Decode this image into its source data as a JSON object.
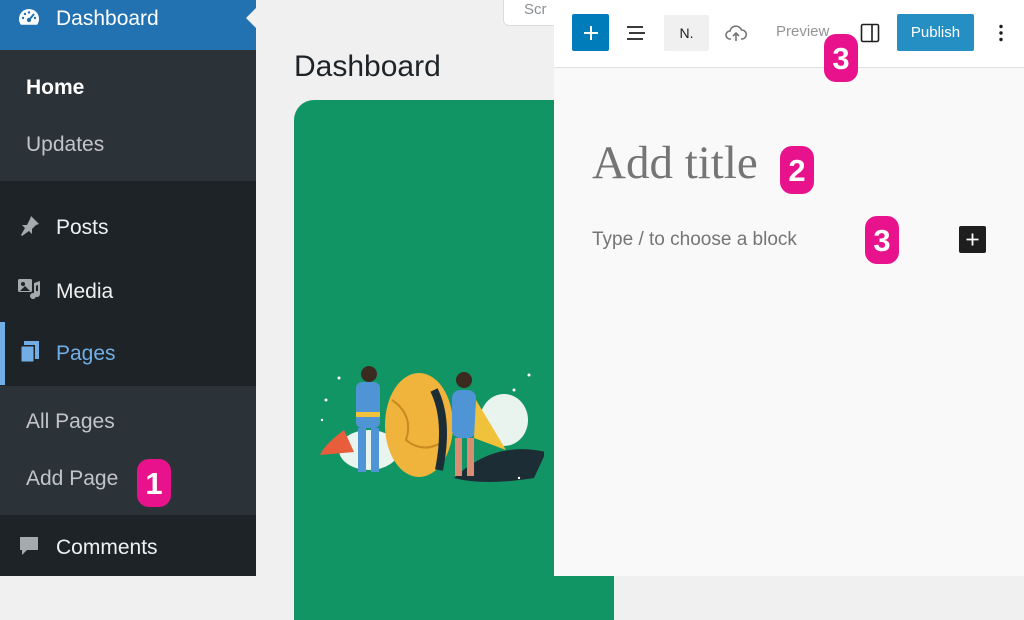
{
  "sidebar": {
    "dashboard_label": "Dashboard",
    "home_label": "Home",
    "updates_label": "Updates",
    "posts_label": "Posts",
    "media_label": "Media",
    "pages_label": "Pages",
    "all_pages_label": "All Pages",
    "add_page_label": "Add Page",
    "comments_label": "Comments"
  },
  "dashboard": {
    "title": "Dashboard",
    "search_placeholder": "Scr"
  },
  "editor": {
    "toolbar": {
      "n_label": "N.",
      "preview_label": "Preview",
      "publish_label": "Publish"
    },
    "title_placeholder": "Add title",
    "block_placeholder": "Type / to choose a block"
  },
  "badges": {
    "add_page": "1",
    "title": "2",
    "toolbar": "3",
    "block": "3"
  },
  "colors": {
    "sidebar_bg": "#1d2327",
    "sidebar_active": "#2271b1",
    "wp_blue": "#007cba",
    "welcome_green": "#119565",
    "badge_pink": "#e8128c"
  },
  "icons": {
    "dashboard": "dashboard-gauge-icon",
    "posts": "pushpin-icon",
    "media": "media-icon",
    "pages": "pages-icon",
    "comments": "speech-bubble-icon",
    "add": "plus-icon",
    "list_view": "list-view-icon",
    "save": "cloud-upload-icon",
    "settings": "sidebar-panel-icon",
    "more": "vertical-ellipsis-icon"
  }
}
